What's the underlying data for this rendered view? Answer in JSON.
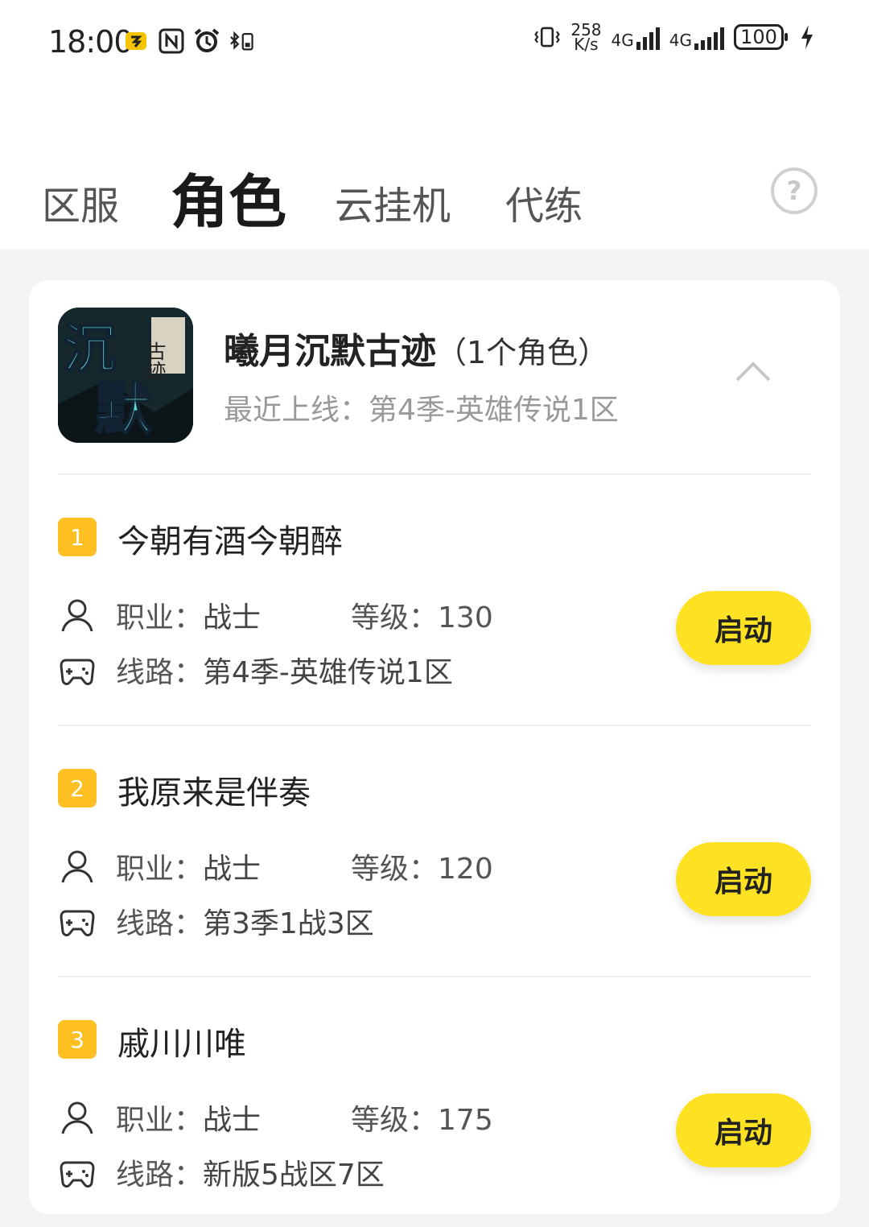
{
  "status": {
    "time": "18:00",
    "speed_top": "258",
    "speed_bottom": "K/s",
    "net1": "4G",
    "net2": "4G",
    "battery": "100"
  },
  "tabs": [
    {
      "label": "区服"
    },
    {
      "label": "角色"
    },
    {
      "label": "云挂机"
    },
    {
      "label": "代练"
    }
  ],
  "help_label": "?",
  "game": {
    "title": "曦月沉默古迹",
    "count": "（1个角色）",
    "last_online": "最近上线：第4季-英雄传说1区",
    "icon_text_big_1": "沉",
    "icon_text_big_2": "默",
    "icon_text_small": "古迹"
  },
  "labels": {
    "job": "职业：",
    "level": "等级：",
    "route": "线路：",
    "start": "启动"
  },
  "roles": [
    {
      "index": "1",
      "name": "今朝有酒今朝醉",
      "job": "战士",
      "level": "130",
      "route": "第4季-英雄传说1区"
    },
    {
      "index": "2",
      "name": "我原来是伴奏",
      "job": "战士",
      "level": "120",
      "route": "第3季1战3区"
    },
    {
      "index": "3",
      "name": "戚川川唯",
      "job": "战士",
      "level": "175",
      "route": "新版5战区7区"
    }
  ],
  "colors": {
    "accent": "#fde224",
    "badge": "#fdbf22"
  }
}
